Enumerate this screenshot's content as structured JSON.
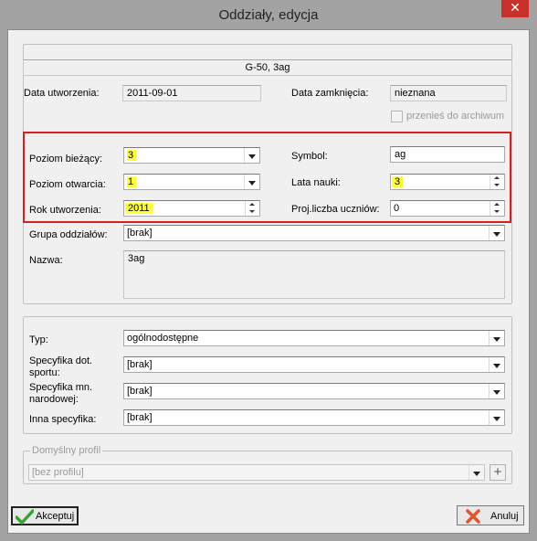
{
  "window": {
    "title": "Oddziały, edycja",
    "close_label": "✕"
  },
  "header": {
    "banner": "G-50, 3ag"
  },
  "dates": {
    "created_label": "Data utworzenia:",
    "created_value": "2011-09-01",
    "closed_label": "Data zamknięcia:",
    "closed_value": "nieznana",
    "archive_label": "przenieś do archiwum"
  },
  "levels": {
    "current_label": "Poziom bieżący:",
    "current_value": "3",
    "opening_label": "Poziom otwarcia:",
    "opening_value": "1",
    "year_label": "Rok utworzenia:",
    "year_value": "2011",
    "symbol_label": "Symbol:",
    "symbol_value": "ag",
    "years_label": "Lata nauki:",
    "years_value": "3",
    "students_label": "Proj.liczba uczniów:",
    "students_value": "0"
  },
  "group": {
    "group_label": "Grupa oddziałów:",
    "group_value": "[brak]",
    "name_label": "Nazwa:",
    "name_value": "3ag"
  },
  "type_section": {
    "type_label": "Typ:",
    "type_value": "ogólnodostępne",
    "sport_label_1": "Specyfika dot.",
    "sport_label_2": "sportu:",
    "sport_value": "[brak]",
    "minority_label_1": "Specyfika mn.",
    "minority_label_2": "narodowej:",
    "minority_value": "[brak]",
    "other_label": "Inna specyfika:",
    "other_value": "[brak]"
  },
  "profile": {
    "legend": "Domyślny profil",
    "value": "[bez profilu]",
    "add_label": "+"
  },
  "footer": {
    "accept_label": "Akceptuj",
    "cancel_label": "Anuluj"
  },
  "colors": {
    "highlight": "#ffff33",
    "red_frame": "#d42020",
    "accept_check": "#3aa335",
    "cancel_x": "#e2552a"
  }
}
